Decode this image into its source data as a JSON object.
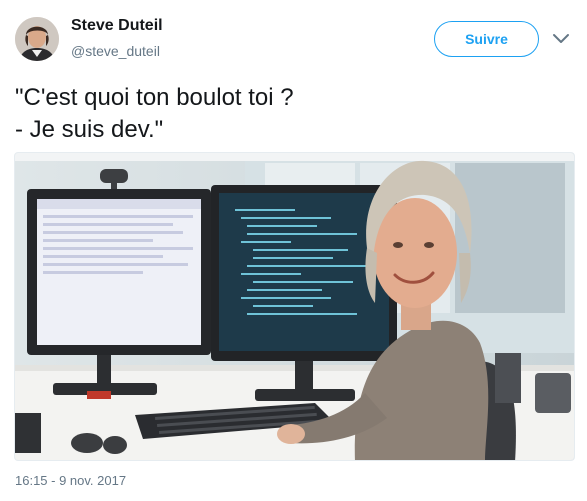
{
  "author": {
    "name": "Steve Duteil",
    "handle": "@steve_duteil"
  },
  "follow_button": {
    "label": "Suivre"
  },
  "tweet": {
    "lines": [
      "\"C'est quoi ton boulot toi ?",
      "- Je suis dev.\""
    ]
  },
  "media": {
    "icon": "photo"
  },
  "timestamp": "16:15 - 9 nov. 2017",
  "colors": {
    "accent": "#1da1f2",
    "secondary_text": "#657786",
    "primary_text": "#14171a"
  }
}
